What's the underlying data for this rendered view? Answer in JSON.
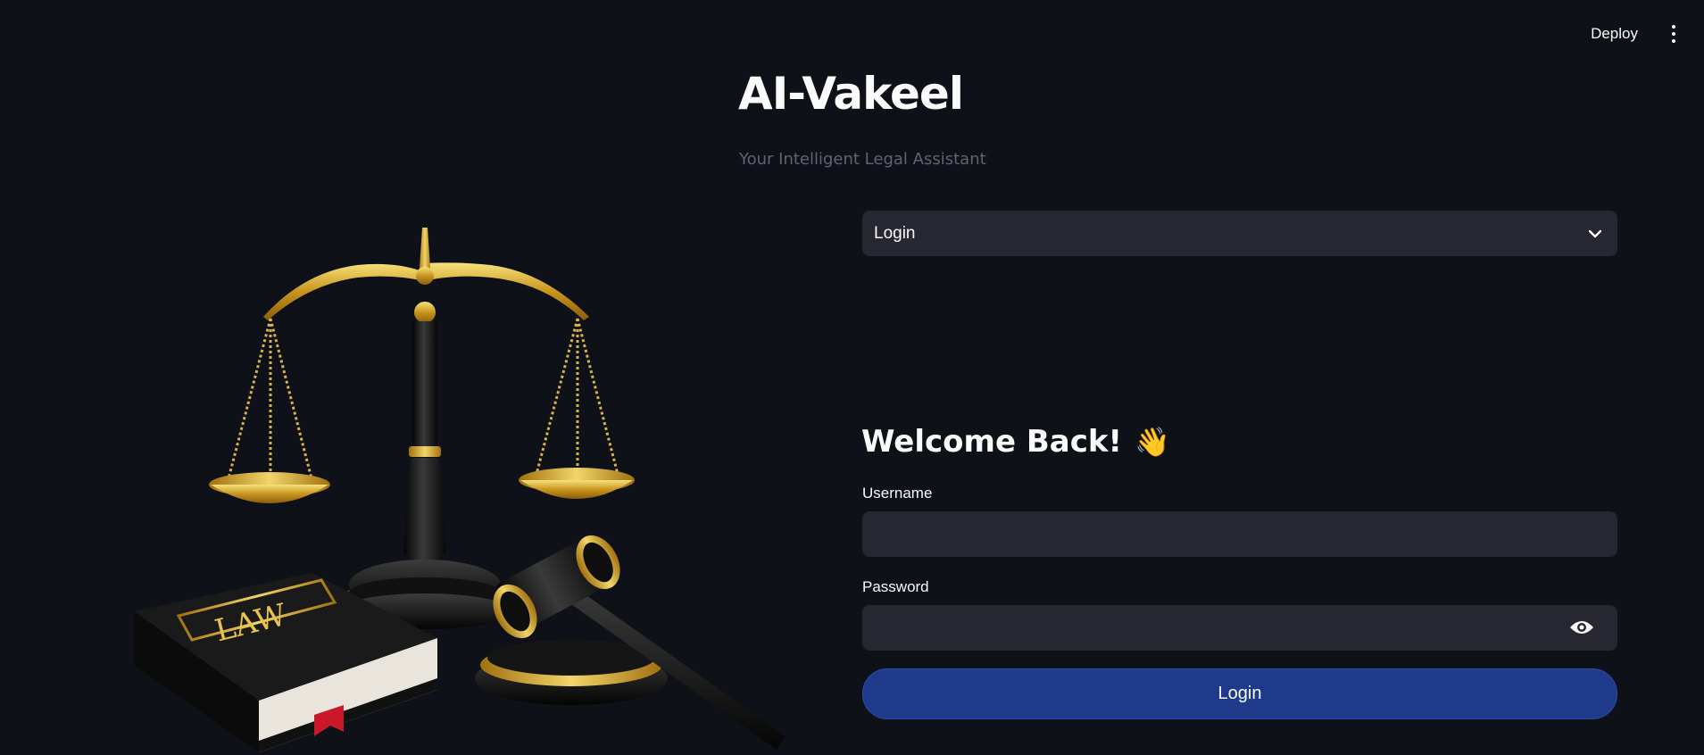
{
  "header": {
    "deploy_label": "Deploy",
    "menu_icon": "more-vertical-icon"
  },
  "app": {
    "title": "AI-Vakeel",
    "subtitle": "Your Intelligent Legal Assistant"
  },
  "illustration": {
    "book_label": "LAW"
  },
  "mode_select": {
    "selected": "Login",
    "icon": "chevron-down-icon"
  },
  "form": {
    "heading": "Welcome Back!",
    "heading_emoji": "👋",
    "username_label": "Username",
    "username_value": "",
    "password_label": "Password",
    "password_value": "",
    "submit_label": "Login"
  },
  "colors": {
    "background": "#0e1117",
    "input_background": "#262730",
    "primary_button": "#1f3a8a",
    "subtitle": "#5d6472",
    "gold": "#d4a62a"
  }
}
